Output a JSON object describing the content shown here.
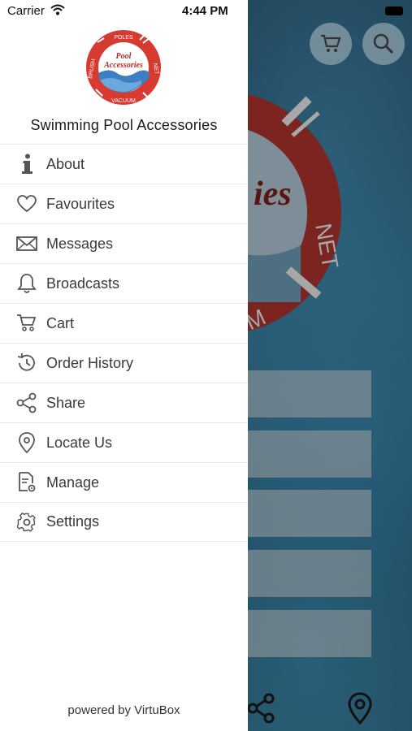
{
  "status_bar": {
    "carrier": "Carrier",
    "time": "4:44 PM"
  },
  "drawer": {
    "logo": {
      "words": [
        "POLES",
        "NET",
        "VACUUM",
        "BRUSH"
      ],
      "script_text": [
        "Pool",
        "Accessories"
      ]
    },
    "app_name": "Swimming Pool Accessories",
    "menu": [
      {
        "label": "About",
        "icon": "info-icon"
      },
      {
        "label": "Favourites",
        "icon": "heart-icon"
      },
      {
        "label": "Messages",
        "icon": "envelope-icon"
      },
      {
        "label": "Broadcasts",
        "icon": "bell-icon"
      },
      {
        "label": "Cart",
        "icon": "cart-icon"
      },
      {
        "label": "Order History",
        "icon": "history-icon"
      },
      {
        "label": "Share",
        "icon": "share-icon"
      },
      {
        "label": "Locate Us",
        "icon": "location-pin-icon"
      },
      {
        "label": "Manage",
        "icon": "manage-icon"
      },
      {
        "label": "Settings",
        "icon": "gear-icon"
      }
    ],
    "footer": "powered by VirtuBox"
  },
  "background": {
    "header_icons": [
      "cart-icon",
      "search-icon"
    ],
    "bottom_icons": [
      "share-icon",
      "location-pin-icon"
    ],
    "logo_visible_text": [
      "NET",
      "ies",
      "M"
    ]
  },
  "colors": {
    "accent_red": "#d63a30",
    "drawer_bg": "#ffffff",
    "icon_gray": "#555555"
  }
}
